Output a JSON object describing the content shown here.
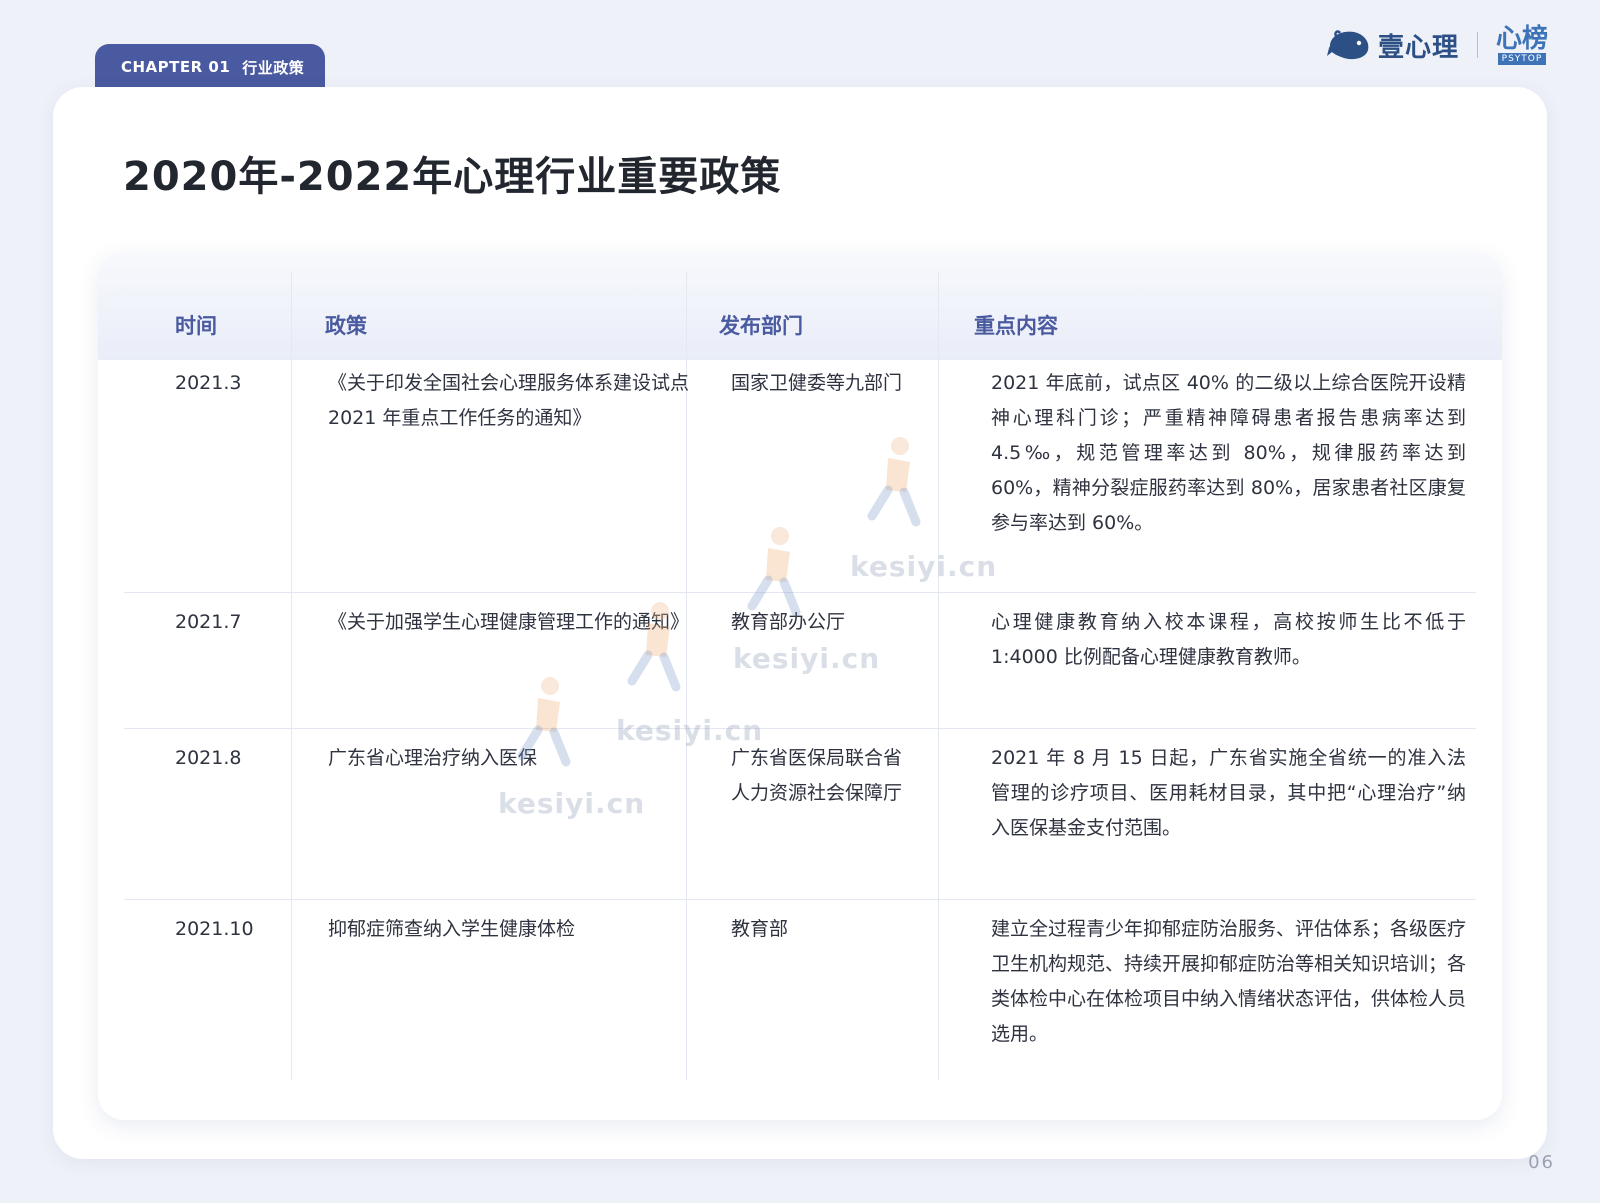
{
  "header": {
    "chapter_number": "CHAPTER 01",
    "chapter_title": "行业政策",
    "brand_name": "壹心理",
    "psytop_main": "心榜",
    "psytop_sub": "PSYTOP"
  },
  "page": {
    "title": "2020年-2022年心理行业重要政策",
    "page_number": "06"
  },
  "table": {
    "headers": {
      "time": "时间",
      "policy": "政策",
      "dept": "发布部门",
      "content": "重点内容"
    },
    "rows": [
      {
        "time": "2021.3",
        "policy": "《关于印发全国社会心理服务体系建设试点 2021 年重点工作任务的通知》",
        "dept": "国家卫健委等九部门",
        "content": "2021 年底前，试点区 40% 的二级以上综合医院开设精神心理科门诊；严重精神障碍患者报告患病率达到 4.5‰，规范管理率达到 80%，规律服药率达到 60%，精神分裂症服药率达到 80%，居家患者社区康复参与率达到 60%。"
      },
      {
        "time": "2021.7",
        "policy": "《关于加强学生心理健康管理工作的通知》",
        "dept": "教育部办公厅",
        "content": "心理健康教育纳入校本课程，高校按师生比不低于 1:4000 比例配备心理健康教育教师。"
      },
      {
        "time": "2021.8",
        "policy": "广东省心理治疗纳入医保",
        "dept": "广东省医保局联合省人力资源社会保障厅",
        "content": "2021 年 8 月 15 日起，广东省实施全省统一的准入法管理的诊疗项目、医用耗材目录，其中把“心理治疗”纳入医保基金支付范围。"
      },
      {
        "time": "2021.10",
        "policy": "抑郁症筛查纳入学生健康体检",
        "dept": "教育部",
        "content": "建立全过程青少年抑郁症防治服务、评估体系；各级医疗卫生机构规范、持续开展抑郁症防治等相关知识培训；各类体检中心在体检项目中纳入情绪状态评估，供体检人员选用。"
      }
    ]
  },
  "watermark": {
    "text": "kesiyi.cn"
  },
  "colors": {
    "accent": "#4a5aa0",
    "background": "#eef1f8",
    "brand_blue": "#2c4f86"
  }
}
